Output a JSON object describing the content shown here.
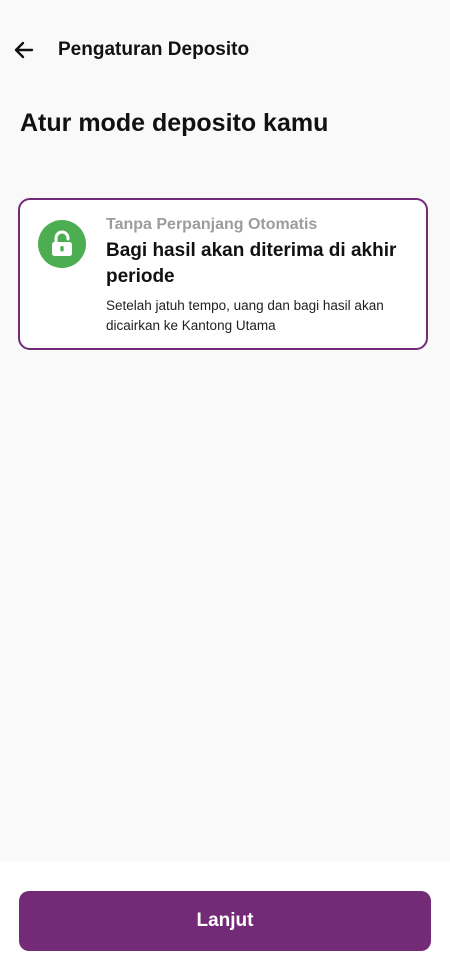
{
  "header": {
    "back_icon": "arrow-left-icon",
    "title": "Pengaturan Deposito"
  },
  "main": {
    "heading": "Atur mode deposito kamu",
    "option": {
      "icon": "unlocked-padlock-icon",
      "overline": "Tanpa Perpanjang Otomatis",
      "title": "Bagi hasil akan diterima di akhir periode",
      "description": "Setelah jatuh tempo, uang dan bagi hasil akan dicairkan ke Kantong Utama",
      "selected": true
    }
  },
  "footer": {
    "continue_label": "Lanjut"
  },
  "colors": {
    "accent": "#732b78",
    "icon_badge": "#4cae50",
    "background": "#f9f9f9",
    "muted_text": "#9c9c9c"
  }
}
